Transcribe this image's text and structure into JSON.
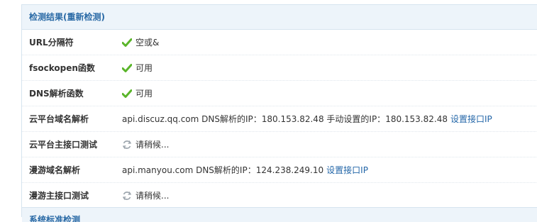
{
  "header": {
    "title": "检测结果(重新检测)"
  },
  "rows": [
    {
      "label": "URL分隔符",
      "status": "空或&"
    },
    {
      "label": "fsockopen函数",
      "status": "可用"
    },
    {
      "label": "DNS解析函数",
      "status": "可用"
    },
    {
      "label": "云平台域名解析",
      "domain": "api.discuz.qq.com",
      "dns_label": "DNS解析的IP：",
      "dns_ip": "180.153.82.48",
      "manual_label": "手动设置的IP：",
      "manual_ip": "180.153.82.48",
      "link": "设置接口IP"
    },
    {
      "label": "云平台主接口测试",
      "status": "请稍候..."
    },
    {
      "label": "漫游域名解析",
      "domain": "api.manyou.com",
      "dns_label": "DNS解析的IP：",
      "dns_ip": "124.238.249.10",
      "link": "设置接口IP"
    },
    {
      "label": "漫游主接口测试",
      "status": "请稍候..."
    }
  ],
  "next_section": {
    "title": "系统标准检测"
  },
  "icons": {
    "ok": "check-icon",
    "loading": "refresh-spinner-icon"
  },
  "colors": {
    "header_bg": "#edf4fa",
    "header_text": "#2a6aa6",
    "ok": "#5ab52a",
    "link": "#2366a8"
  }
}
